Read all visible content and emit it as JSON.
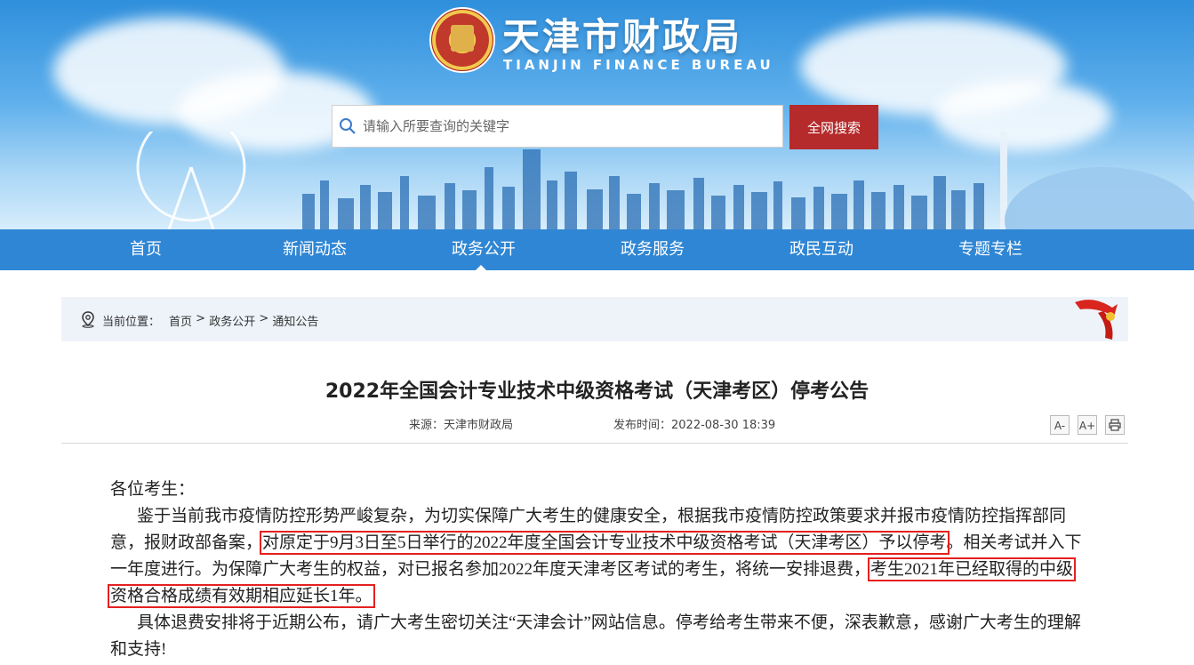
{
  "header": {
    "site_title": "天津市财政局",
    "site_subtitle": "TIANJIN FINANCE BUREAU",
    "search_placeholder": "请输入所要查询的关键字",
    "search_button": "全网搜索"
  },
  "nav": {
    "items": [
      {
        "label": "首页"
      },
      {
        "label": "新闻动态"
      },
      {
        "label": "政务公开"
      },
      {
        "label": "政务服务"
      },
      {
        "label": "政民互动"
      },
      {
        "label": "专题专栏"
      }
    ],
    "active": "政务公开"
  },
  "breadcrumb": {
    "prefix": "当前位置：",
    "items": [
      "首页",
      "政务公开",
      "通知公告"
    ],
    "separator": " > "
  },
  "article": {
    "title": "2022年全国会计专业技术中级资格考试（天津考区）停考公告",
    "source_label": "来源：",
    "source": "天津市财政局",
    "date_label": "发布时间：",
    "date": "2022-08-30 18:39",
    "tools": {
      "font_smaller": "A-",
      "font_larger": "A+",
      "print": "print-icon"
    },
    "greeting": "各位考生：",
    "p1_a": "鉴于当前我市疫情防控形势严峻复杂，为切实保障广大考生的健康安全，根据我市疫情防控政策要求并报市疫情防控指挥部同意，报财政部备案，",
    "p1_hl1": "对原定于9月3日至5日举行的2022年度全国会计专业技术中级资格考试（天津考区）予以停考",
    "p1_b": "。相关考试并入下一年度进行。为保障广大考生的权益，对已报名参加2022年度天津考区考试的考生，将统一安排退费，",
    "p1_hl2": "考生2021年已经取得的中级资格合格成绩有效期相应延长1年。",
    "p2": "具体退费安排将于近期公布，请广大考生密切关注“天津会计”网站信息。停考给考生带来不便，深表歉意，感谢广大考生的理解和支持!"
  },
  "colors": {
    "nav_bg": "#2f86d4",
    "search_button_bg": "#b52a2a",
    "highlight_border": "#e52020",
    "crumb_bg": "#eef3fa"
  }
}
